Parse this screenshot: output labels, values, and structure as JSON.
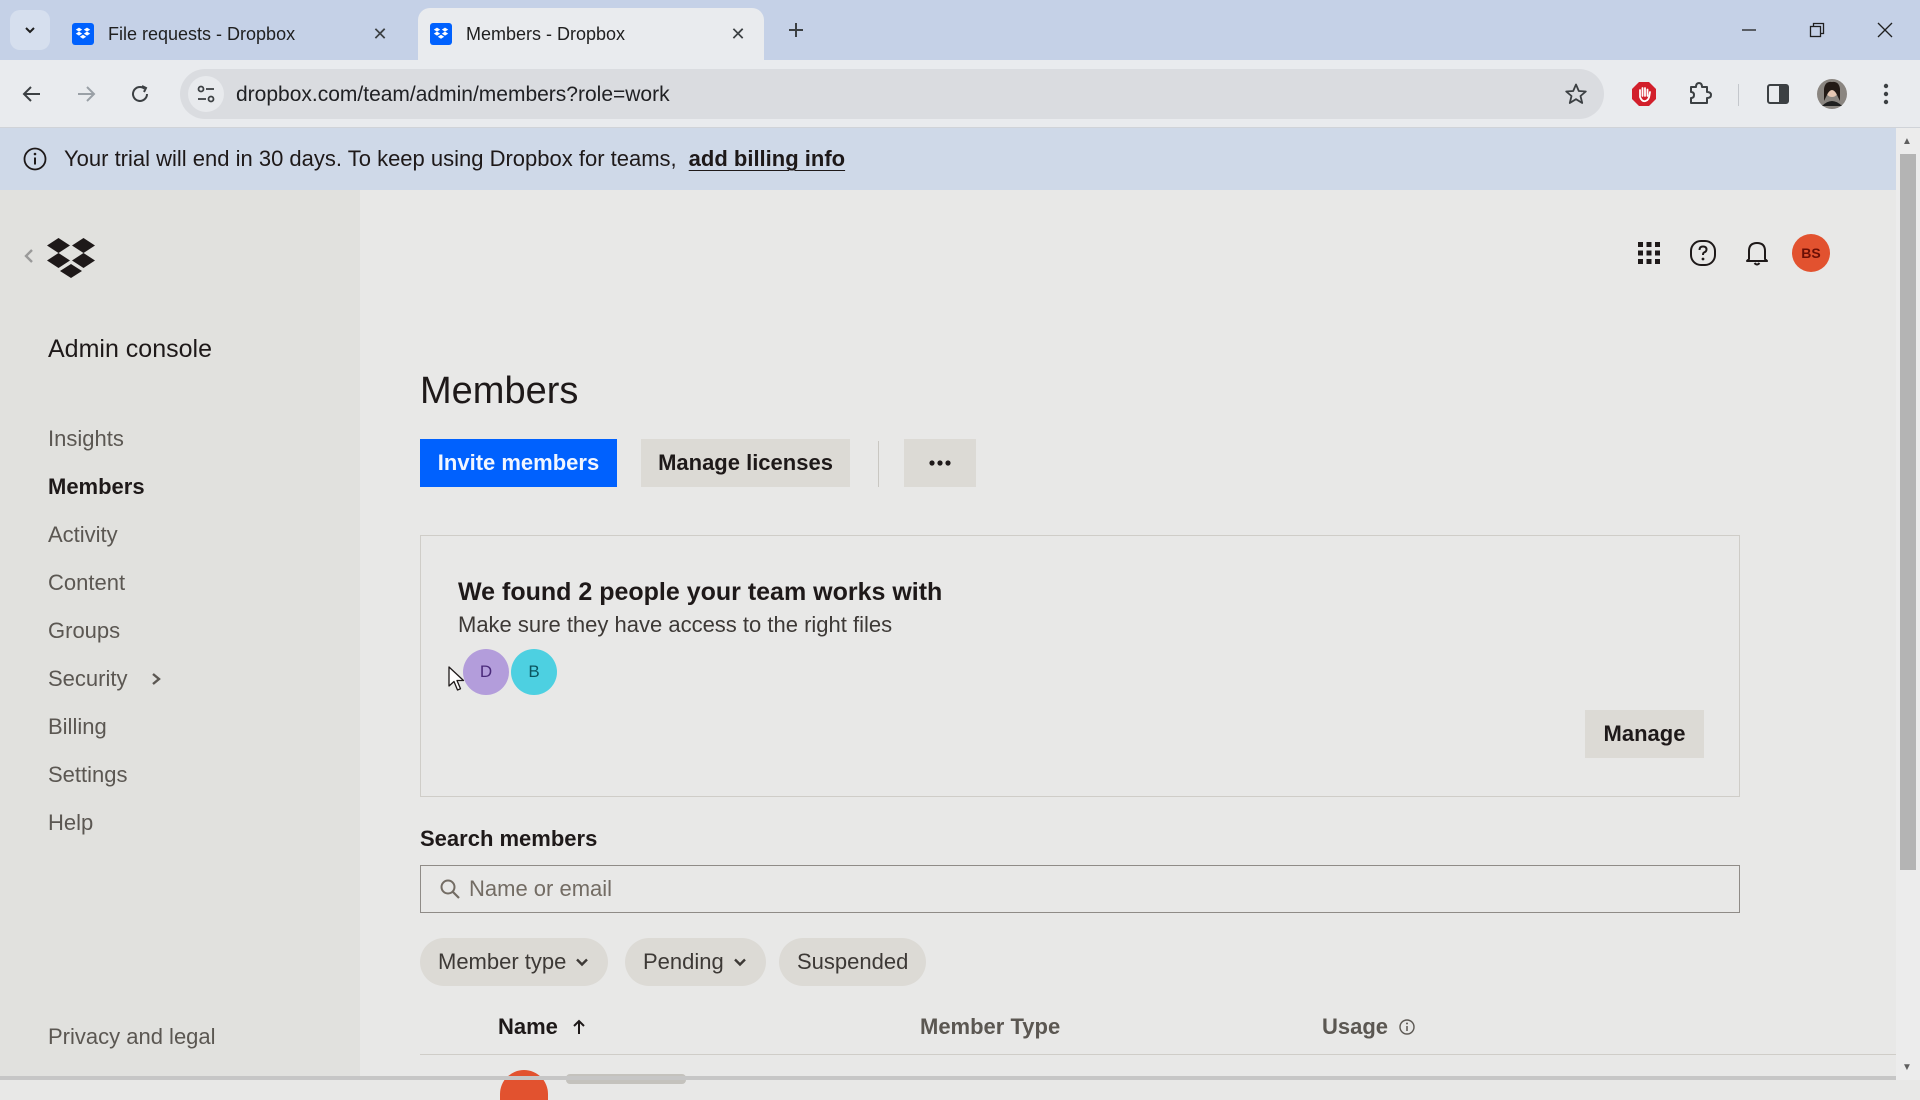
{
  "browser": {
    "tabs": [
      {
        "title": "File requests - Dropbox",
        "active": false
      },
      {
        "title": "Members - Dropbox",
        "active": true
      }
    ],
    "url": "dropbox.com/team/admin/members?role=work",
    "icons": {
      "tab_list": "chevron-down-icon",
      "new_tab": "plus-icon",
      "back": "arrow-left-icon",
      "forward": "arrow-right-icon",
      "reload": "reload-icon",
      "site_info": "tune-icon",
      "bookmark": "star-icon",
      "adblock": "stop-hand-icon",
      "extensions": "puzzle-icon",
      "side_panel": "side-panel-icon",
      "profile": "profile-photo",
      "menu": "kebab-menu-icon"
    },
    "accent_color": "#c5d1e7"
  },
  "banner": {
    "text": "Your trial will end in 30 days. To keep using Dropbox for teams,",
    "link": "add billing info"
  },
  "sidebar": {
    "title": "Admin console",
    "items": [
      {
        "label": "Insights",
        "active": false
      },
      {
        "label": "Members",
        "active": true
      },
      {
        "label": "Activity",
        "active": false
      },
      {
        "label": "Content",
        "active": false
      },
      {
        "label": "Groups",
        "active": false
      },
      {
        "label": "Security",
        "active": false,
        "has_submenu": true
      },
      {
        "label": "Billing",
        "active": false
      },
      {
        "label": "Settings",
        "active": false
      },
      {
        "label": "Help",
        "active": false
      }
    ],
    "footer_link": "Privacy and legal"
  },
  "header": {
    "user_initials": "BS",
    "user_avatar_color": "#e2522f"
  },
  "main": {
    "title": "Members",
    "actions": {
      "invite": "Invite members",
      "manage_licenses": "Manage licenses",
      "more": "•••"
    },
    "suggestion": {
      "title": "We found 2 people your team works with",
      "subtitle": "Make sure they have access to the right files",
      "people": [
        {
          "initial": "D",
          "color": "#b39ddb",
          "text_color": "#4a2a7a"
        },
        {
          "initial": "B",
          "color": "#4dd0e1",
          "text_color": "#0b5560"
        }
      ],
      "manage_label": "Manage"
    },
    "search": {
      "label": "Search members",
      "placeholder": "Name or email",
      "value": ""
    },
    "filters": [
      {
        "label": "Member type",
        "dropdown": true
      },
      {
        "label": "Pending",
        "dropdown": true
      },
      {
        "label": "Suspended",
        "dropdown": false
      }
    ],
    "table": {
      "columns": [
        {
          "label": "Name",
          "sort": "ascending"
        },
        {
          "label": "Member Type"
        },
        {
          "label": "Usage",
          "info": true
        }
      ]
    },
    "primary_color": "#0061fe"
  }
}
